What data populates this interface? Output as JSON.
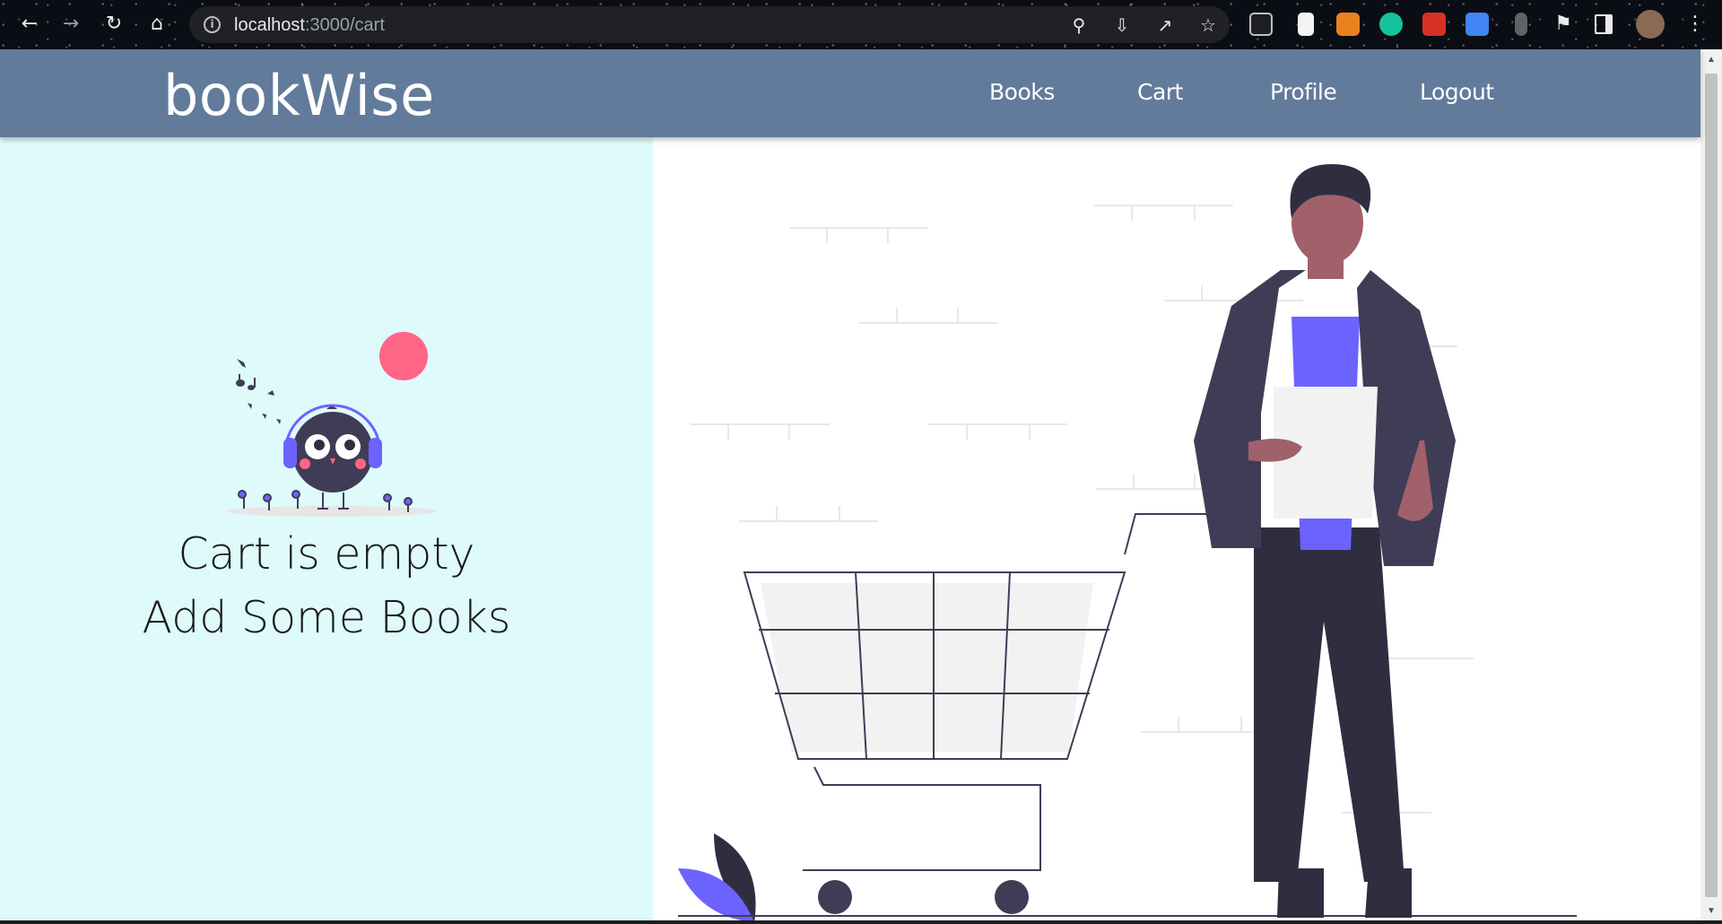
{
  "browser": {
    "back_icon": "arrow-left-icon",
    "forward_icon": "arrow-right-icon",
    "reload_icon": "reload-icon",
    "home_icon": "home-icon",
    "url_host": "localhost",
    "url_path": ":3000/cart",
    "omnibox_icons": [
      "key-icon",
      "install-icon",
      "share-icon",
      "star-icon"
    ],
    "extensions": [
      "reader-icon",
      "doc-icon",
      "metamask-icon",
      "grammarly-icon",
      "extension-red-icon",
      "translate-icon",
      "mic-icon",
      "puzzle-icon",
      "sidepanel-icon",
      "profile-avatar",
      "menu-icon"
    ]
  },
  "header": {
    "brand": "bookWise",
    "nav": [
      "Books",
      "Cart",
      "Profile",
      "Logout"
    ]
  },
  "main": {
    "line1": "Cart is empty",
    "line2": "Add Some Books"
  },
  "colors": {
    "header_bg": "#627b9a",
    "left_bg": "#dffafa",
    "accent_pink": "#ff6584",
    "accent_purple": "#6c63ff",
    "dark": "#3f3d56"
  }
}
